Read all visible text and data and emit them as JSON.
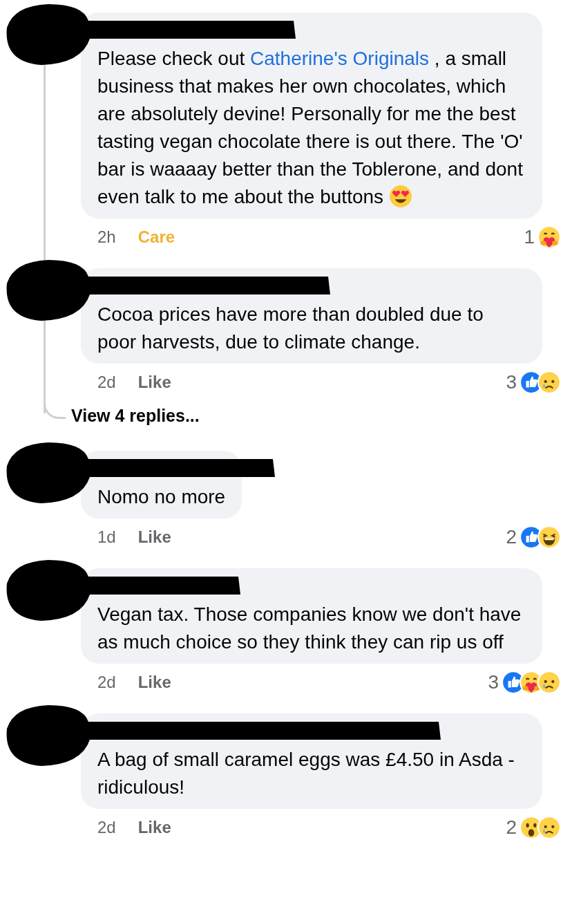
{
  "comments": [
    {
      "reply": true,
      "parts": [
        {
          "kind": "text",
          "text": "Please check out "
        },
        {
          "kind": "link",
          "text": "Catherine's Originals"
        },
        {
          "kind": "text",
          "text": " , a small business that makes her own chocolates, which are absolutely devine! Personally for me the best tasting vegan chocolate there is out there.  The 'O' bar is waaaay better than the Toblerone,  and dont even talk to me about the buttons "
        },
        {
          "kind": "emoji"
        }
      ],
      "time": "2h",
      "action": "Care",
      "reacted": true,
      "count": "1",
      "reactions": [
        {
          "kind": "care"
        }
      ]
    },
    {
      "reply": true,
      "parts": [
        {
          "kind": "text",
          "text": "Cocoa prices have more than doubled due to poor harvests, due to climate change."
        }
      ],
      "time": "2d",
      "action": "Like",
      "reacted": false,
      "count": "3",
      "reactions": [
        {
          "kind": "like"
        },
        {
          "kind": "sad"
        }
      ]
    },
    {
      "reply": false,
      "parts": [
        {
          "kind": "text",
          "text": "Nomo no more"
        }
      ],
      "time": "1d",
      "action": "Like",
      "reacted": false,
      "count": "2",
      "reactions": [
        {
          "kind": "like"
        },
        {
          "kind": "laugh"
        }
      ]
    },
    {
      "reply": false,
      "parts": [
        {
          "kind": "text",
          "text": "Vegan tax. Those companies know we don't have as much choice so they think they can rip us off"
        }
      ],
      "time": "2d",
      "action": "Like",
      "reacted": false,
      "count": "3",
      "reactions": [
        {
          "kind": "like"
        },
        {
          "kind": "care"
        },
        {
          "kind": "sad"
        }
      ]
    },
    {
      "reply": false,
      "parts": [
        {
          "kind": "text",
          "text": "A bag of small caramel eggs was £4.50 in Asda - ridiculous!"
        }
      ],
      "time": "2d",
      "action": "Like",
      "reacted": false,
      "count": "2",
      "reactions": [
        {
          "kind": "wow"
        },
        {
          "kind": "sad"
        }
      ]
    }
  ],
  "view_replies": "View 4 replies..."
}
